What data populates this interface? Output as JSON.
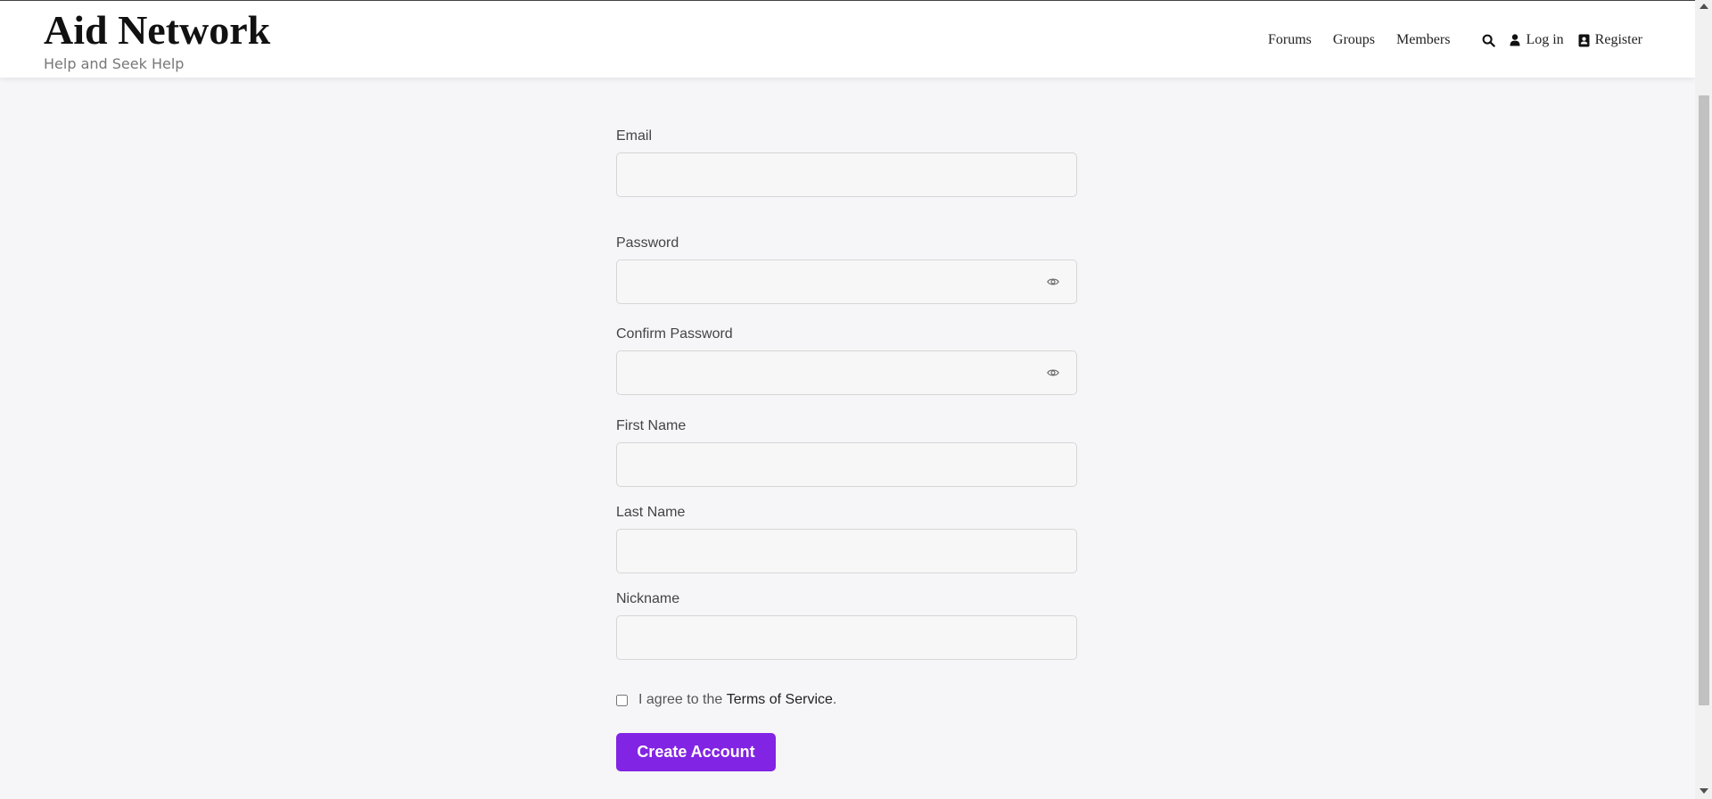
{
  "header": {
    "site_title": "Aid Network",
    "tagline": "Help and Seek Help",
    "nav": {
      "forums": "Forums",
      "groups": "Groups",
      "members": "Members"
    },
    "login_label": "Log in",
    "register_label": "Register"
  },
  "form": {
    "email_label": "Email",
    "email_value": "",
    "password_label": "Password",
    "password_value": "",
    "confirm_password_label": "Confirm Password",
    "confirm_password_value": "",
    "first_name_label": "First Name",
    "first_name_value": "",
    "last_name_label": "Last Name",
    "last_name_value": "",
    "nickname_label": "Nickname",
    "nickname_value": "",
    "terms_prefix": "I agree to the",
    "terms_link": "Terms of Service",
    "terms_suffix": ".",
    "terms_checked": false,
    "submit_label": "Create Account"
  },
  "colors": {
    "accent": "#8224e3",
    "page_background": "#f6f6f8"
  },
  "icons": {
    "search": "search-icon",
    "login": "user-icon",
    "register": "address-card-icon",
    "password_toggle": "eye-icon"
  }
}
